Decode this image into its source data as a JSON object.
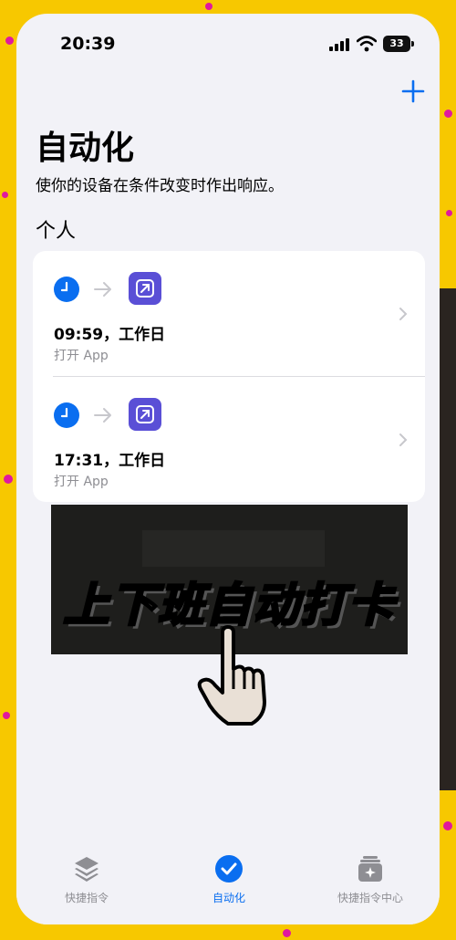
{
  "status_bar": {
    "time": "20:39",
    "battery": "33"
  },
  "header": {
    "title": "自动化",
    "subtitle": "使你的设备在条件改变时作出响应。",
    "add_icon": "plus-icon"
  },
  "section": {
    "title": "个人"
  },
  "automations": [
    {
      "trigger_icon": "clock-icon",
      "action_icon": "open-app-icon",
      "title": "09:59，工作日",
      "subtitle": "打开 App"
    },
    {
      "trigger_icon": "clock-icon",
      "action_icon": "open-app-icon",
      "title": "17:31，工作日",
      "subtitle": "打开 App"
    }
  ],
  "banner": {
    "text": "上下班自动打卡"
  },
  "tab_bar": {
    "tabs": [
      {
        "label": "快捷指令",
        "icon": "layers-icon",
        "active": false
      },
      {
        "label": "自动化",
        "icon": "check-circle-icon",
        "active": true
      },
      {
        "label": "快捷指令中心",
        "icon": "gallery-icon",
        "active": false
      }
    ]
  },
  "colors": {
    "accent": "#0a6ef0",
    "app_icon": "#5a4fd6",
    "frame": "#f7c800",
    "dots": "#e0199e"
  }
}
